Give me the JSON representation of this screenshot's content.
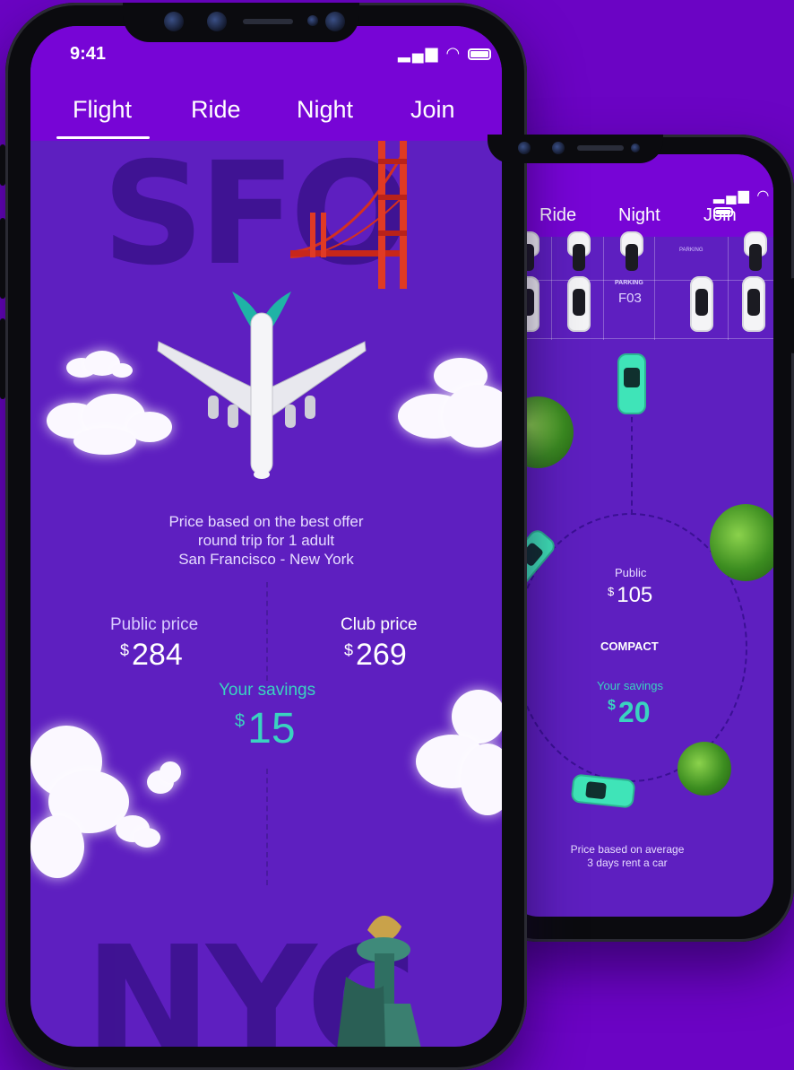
{
  "front_phone": {
    "status": {
      "time": "9:41",
      "icons": [
        "signal-icon",
        "wifi-icon",
        "battery-icon"
      ]
    },
    "tabs": [
      {
        "label": "Flight",
        "active": true
      },
      {
        "label": "Ride",
        "active": false
      },
      {
        "label": "Night",
        "active": false
      },
      {
        "label": "Join",
        "active": false
      }
    ],
    "origin_code": "SFO",
    "destination_code": "NYC",
    "description": {
      "line1": "Price based on the best offer",
      "line2": "round trip for 1 adult",
      "line3": "San Francisco - New York"
    },
    "public_price": {
      "label": "Public price",
      "currency": "$",
      "amount": "284"
    },
    "club_price": {
      "label": "Club price",
      "currency": "$",
      "amount": "269"
    },
    "savings": {
      "label": "Your savings",
      "currency": "$",
      "amount": "15"
    }
  },
  "back_phone": {
    "tabs": [
      {
        "label": "Ride"
      },
      {
        "label": "Night"
      },
      {
        "label": "Join"
      }
    ],
    "parking": {
      "label": "PARKING",
      "spot": "F03",
      "small_label": "PARKING"
    },
    "public_price": {
      "label": "Public",
      "currency": "$",
      "amount": "105"
    },
    "car_class": "COMPACT",
    "savings": {
      "label": "Your savings",
      "currency": "$",
      "amount": "20"
    },
    "footnote": {
      "line1": "Price based on average",
      "line2": "3 days rent a car"
    }
  },
  "colors": {
    "background": "#6b04c4",
    "topbar": "#7705d6",
    "screen": "#5e1fc0",
    "accent_teal": "#3ad3c0"
  }
}
